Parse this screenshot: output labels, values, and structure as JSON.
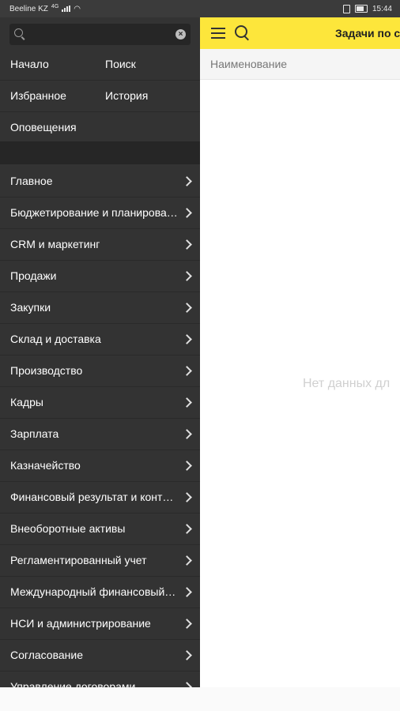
{
  "status_bar": {
    "carrier": "Beeline KZ",
    "network": "4G",
    "time": "15:44"
  },
  "drawer": {
    "search": {
      "placeholder": "",
      "value": ""
    },
    "top_links": {
      "home": "Начало",
      "search": "Поиск",
      "favorites": "Избранное",
      "history": "История",
      "notifications": "Оповещения"
    },
    "sections": [
      "Главное",
      "Бюджетирование и планирование",
      "CRM и маркетинг",
      "Продажи",
      "Закупки",
      "Склад и доставка",
      "Производство",
      "Кадры",
      "Зарплата",
      "Казначейство",
      "Финансовый результат и контроллинг",
      "Внеоборотные активы",
      "Регламентированный учет",
      "Международный финансовый учет",
      "НСИ и администрирование",
      "Согласование",
      "Управление договорами"
    ]
  },
  "content": {
    "title": "Задачи по со",
    "column_header": "Наименование",
    "empty_message": "Нет данных дл"
  },
  "colors": {
    "accent_yellow": "#fde63b",
    "drawer_bg": "#333333"
  }
}
